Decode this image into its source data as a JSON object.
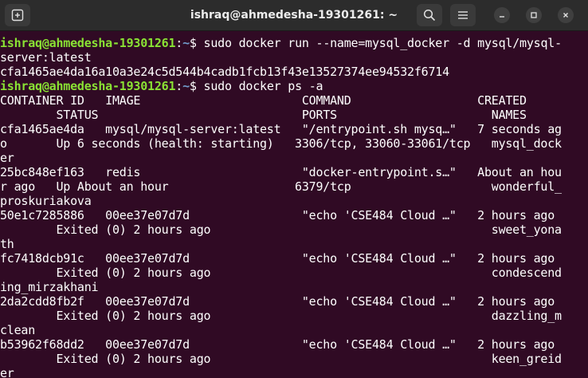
{
  "window": {
    "title": "ishraq@ahmedesha-19301261: ~"
  },
  "icons": {
    "new_tab": "new-tab-icon",
    "search": "search-icon",
    "menu": "hamburger-menu-icon",
    "minimize": "minimize-icon",
    "maximize": "maximize-icon",
    "close": "close-icon"
  },
  "prompt": {
    "user_host": "ishraq@ahmedesha-19301261",
    "sep": ":",
    "path": "~",
    "symbol": "$ "
  },
  "lines": [
    {
      "type": "prompt",
      "cmd": "sudo docker run --name=mysql_docker -d mysql/mysql-"
    },
    {
      "type": "out",
      "text": "server:latest"
    },
    {
      "type": "out",
      "text": "cfa1465ae4da16a10a3e24c5d544b4cadb1fcb13f43e13527374ee94532f6714"
    },
    {
      "type": "prompt",
      "cmd": "sudo docker ps -a"
    },
    {
      "type": "out",
      "text": "CONTAINER ID   IMAGE                       COMMAND                  CREATED"
    },
    {
      "type": "out",
      "text": "        STATUS                             PORTS                      NAMES"
    },
    {
      "type": "out",
      "text": "cfa1465ae4da   mysql/mysql-server:latest   \"/entrypoint.sh mysq…\"   7 seconds ag"
    },
    {
      "type": "out",
      "text": "o       Up 6 seconds (health: starting)   3306/tcp, 33060-33061/tcp   mysql_dock"
    },
    {
      "type": "out",
      "text": "er"
    },
    {
      "type": "out",
      "text": "25bc848ef163   redis                       \"docker-entrypoint.s…\"   About an hou"
    },
    {
      "type": "out",
      "text": "r ago   Up About an hour                  6379/tcp                    wonderful_"
    },
    {
      "type": "out",
      "text": "proskuriakova"
    },
    {
      "type": "out",
      "text": "50e1c7285886   00ee37e07d7d                \"echo 'CSE484 Cloud …\"   2 hours ago"
    },
    {
      "type": "out",
      "text": "        Exited (0) 2 hours ago                                        sweet_yona"
    },
    {
      "type": "out",
      "text": "th"
    },
    {
      "type": "out",
      "text": "fc7418dcb91c   00ee37e07d7d                \"echo 'CSE484 Cloud …\"   2 hours ago"
    },
    {
      "type": "out",
      "text": "        Exited (0) 2 hours ago                                        condescend"
    },
    {
      "type": "out",
      "text": "ing_mirzakhani"
    },
    {
      "type": "out",
      "text": "2da2cdd8fb2f   00ee37e07d7d                \"echo 'CSE484 Cloud …\"   2 hours ago"
    },
    {
      "type": "out",
      "text": "        Exited (0) 2 hours ago                                        dazzling_m"
    },
    {
      "type": "out",
      "text": "clean"
    },
    {
      "type": "out",
      "text": "b53962f68dd2   00ee37e07d7d                \"echo 'CSE484 Cloud …\"   2 hours ago"
    },
    {
      "type": "out",
      "text": "        Exited (0) 2 hours ago                                        keen_greid"
    },
    {
      "type": "out",
      "text": "er"
    }
  ],
  "colors": {
    "background": "#300a24",
    "prompt_user": "#8ae234",
    "prompt_path": "#729fcf",
    "titlebar": "#2c2c2c"
  }
}
